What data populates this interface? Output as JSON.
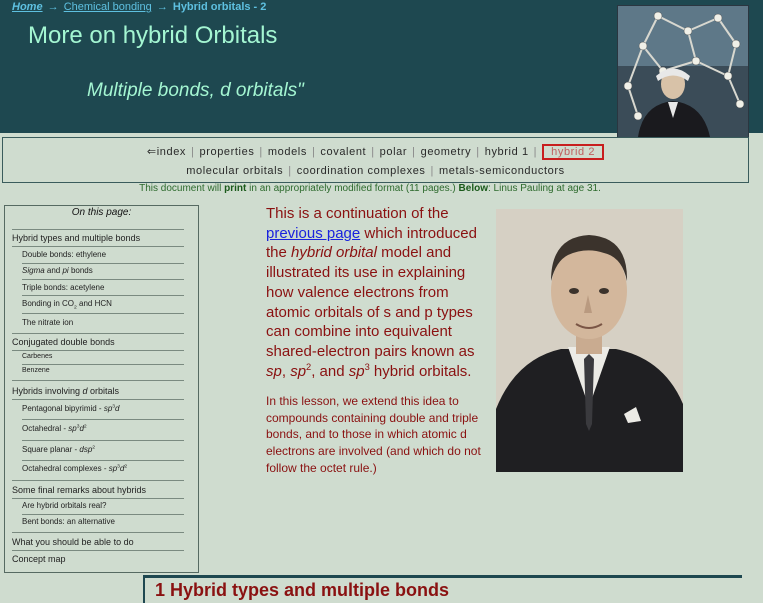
{
  "breadcrumb": {
    "home": "Home",
    "parent": "Chemical bonding",
    "current": "Hybrid orbitals - 2",
    "arrow": "→"
  },
  "header": {
    "title": "More on hybrid Orbitals",
    "subtitle": "Multiple bonds, d orbitals\""
  },
  "nav": {
    "row1": [
      "⇐index",
      "properties",
      "models",
      "covalent",
      "polar",
      "geometry",
      "hybrid 1"
    ],
    "current": "hybrid 2",
    "row2": [
      "molecular orbitals",
      "coordination complexes",
      "metals-semiconductors"
    ],
    "separator": "|"
  },
  "notice": {
    "pre": "This document will ",
    "bold1": "print",
    "mid": " in an appropriately modified format (11 pages.) ",
    "bold2": "Below",
    "post": ": Linus Pauling at age 31."
  },
  "sidebar": {
    "heading": "On this page:",
    "items": {
      "hybrid_types": "Hybrid types and multiple bonds",
      "double_bonds": "Double bonds: ethylene",
      "sigma": "Sigma",
      "and": " and ",
      "pi": "pi",
      "bonds": " bonds",
      "triple_bonds": "Triple bonds: acetylene",
      "bonding_co2_pre": "Bonding in CO",
      "bonding_co2_sub": "2",
      "bonding_co2_post": " and HCN",
      "nitrate": "The nitrate ion",
      "conjugated": "Conjugated double bonds",
      "carbenes": "Carbenes",
      "benzene": "Benzene",
      "hybrids_involving_pre": "Hybrids involving ",
      "hybrids_involving_d": "d",
      "hybrids_involving_post": " orbitals",
      "pentagonal_pre": "Pentagonal bipyrimid - ",
      "pentagonal_sp": "sp",
      "pentagonal_sup": "3",
      "pentagonal_d": "d",
      "octahedral_pre": "Octahedral - ",
      "octahedral_sp": "sp",
      "octahedral_sup": "3",
      "octahedral_d": "d",
      "octahedral_sup2": "2",
      "square_pre": "Square planar - ",
      "square_dsp": "dsp",
      "square_sup": "2",
      "octcomplex_pre": "Octahedral complexes - ",
      "octcomplex_sp": "sp",
      "octcomplex_sup": "3",
      "octcomplex_d": "d",
      "octcomplex_sup2": "2",
      "final_remarks": "Some final remarks about hybrids",
      "are_real": "Are hybrid orbitals real?",
      "bent_bonds": "Bent bonds: an alternative",
      "able_to_do": "What you should be able to do",
      "concept_map": "Concept map"
    }
  },
  "intro": {
    "p1_a": "This is a continuation of the ",
    "p1_link": "previous page",
    "p1_b": " which introduced the ",
    "p1_hybrid": "hybrid orbital",
    "p1_c": " model and illustrated its use in explaining how valence electrons from atomic orbitals of s and p types can combine into equivalent shared-electron pairs known as ",
    "sp": "sp",
    "comma": ", ",
    "sp2": "sp",
    "sup2": "2",
    "and": ", and ",
    "sp3": "sp",
    "sup3": "3",
    "p1_end": " hybrid orbitals.",
    "p2": "In this lesson, we extend this idea to compounds containing double and triple bonds, and to those in which atomic d electrons are involved (and which do not follow the octet rule.)"
  },
  "section": {
    "heading": "1  Hybrid types and multiple bonds"
  },
  "colors": {
    "header_bg": "#1e4850",
    "title": "#a4f6d2",
    "body_bg": "#cfdccf",
    "text_red": "#8a1111",
    "link": "#1a22dd",
    "current_border": "#c81e1e"
  }
}
